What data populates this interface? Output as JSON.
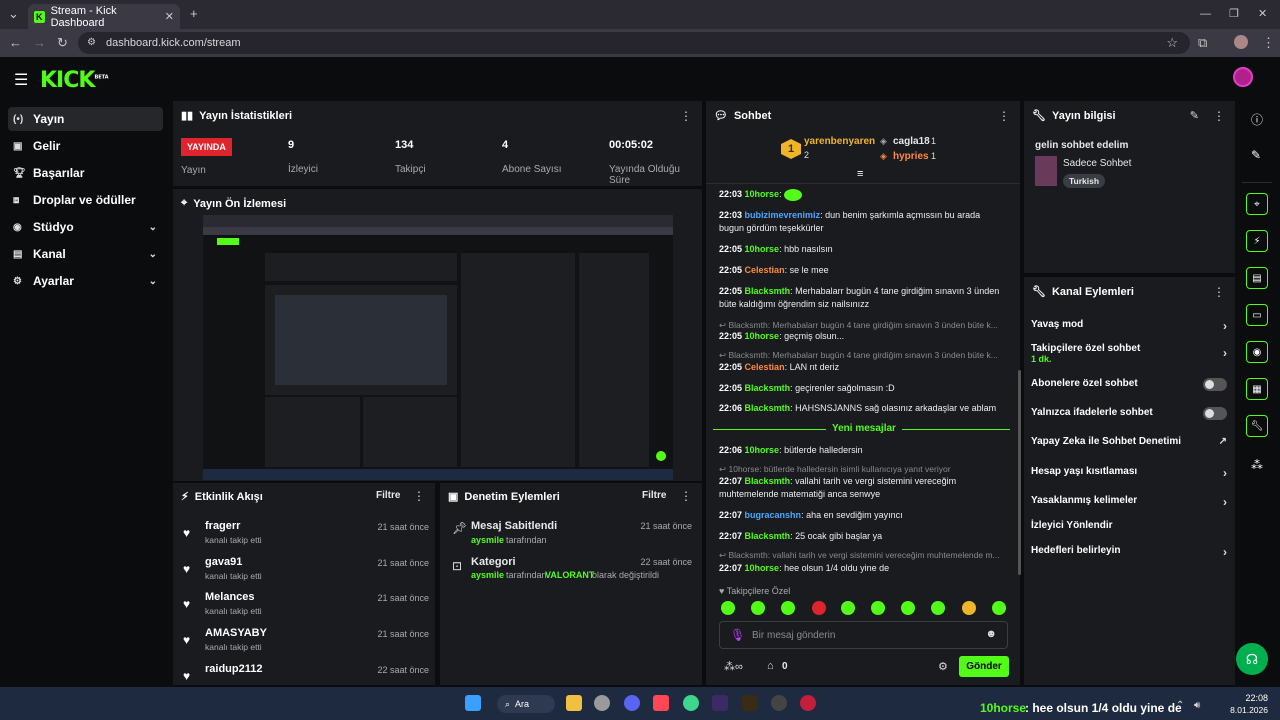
{
  "browser": {
    "tab_title": "Stream - Kick Dashboard",
    "url": "dashboard.kick.com/stream"
  },
  "logo": "KICK",
  "logo_beta": "BETA",
  "sidebar": [
    {
      "label": "Yayın",
      "icon": "broadcast-icon"
    },
    {
      "label": "Gelir",
      "icon": "money-icon"
    },
    {
      "label": "Başarılar",
      "icon": "trophy-icon"
    },
    {
      "label": "Droplar ve ödüller",
      "icon": "gift-icon"
    },
    {
      "label": "Stüdyo",
      "icon": "studio-icon"
    },
    {
      "label": "Kanal",
      "icon": "channel-icon"
    },
    {
      "label": "Ayarlar",
      "icon": "gear-icon"
    }
  ],
  "stats": {
    "title": "Yayın İstatistikleri",
    "live_badge": "YAYINDA",
    "live_label": "Yayın",
    "items": [
      {
        "value": "9",
        "label": "İzleyici"
      },
      {
        "value": "134",
        "label": "Takipçi"
      },
      {
        "value": "4",
        "label": "Abone Sayısı"
      },
      {
        "value": "00:05:02",
        "label": "Yayında Olduğu Süre"
      }
    ]
  },
  "preview": {
    "title": "Yayın Ön İzlemesi"
  },
  "activity": {
    "title": "Etkinlik Akışı",
    "filter": "Filtre",
    "items": [
      {
        "name": "fragerr",
        "sub": "kanalı takip etti",
        "time": "21 saat önce"
      },
      {
        "name": "gava91",
        "sub": "kanalı takip etti",
        "time": "21 saat önce"
      },
      {
        "name": "Melances",
        "sub": "kanalı takip etti",
        "time": "21 saat önce"
      },
      {
        "name": "AMASYABY",
        "sub": "kanalı takip etti",
        "time": "21 saat önce"
      },
      {
        "name": "raidup2112",
        "sub": "",
        "time": "22 saat önce"
      }
    ]
  },
  "moderation": {
    "title": "Denetim Eylemleri",
    "filter": "Filtre",
    "items": [
      {
        "name": "Mesaj Sabitlendi",
        "user": "aysmile",
        "rest": "tarafından",
        "time": "21 saat önce"
      },
      {
        "name": "Kategori",
        "user": "aysmile",
        "rest": "tarafından",
        "game": "VALORANT",
        "rest2": "olarak değiştirildi",
        "time": "22 saat önce"
      }
    ]
  },
  "chat": {
    "title": "Sohbet",
    "leader": {
      "rank": "1",
      "name": "yarenbenyaren",
      "count": "2"
    },
    "others": [
      {
        "name": "cagla18",
        "count": "1"
      },
      {
        "name": "hypries",
        "count": "1"
      }
    ],
    "messages": [
      {
        "time": "22:03",
        "user": "10horse",
        "text": ":",
        "color": "#53fc18"
      },
      {
        "time": "22:03",
        "user": "bubizimevrenimiz",
        "text": ": dun benim şarkımla açmıssın bu arada bugun gördüm teşekkürler",
        "color": "#4aa8ff"
      },
      {
        "time": "22:05",
        "user": "10horse",
        "text": ": hbb nasılsın",
        "color": "#53fc18"
      },
      {
        "time": "22:05",
        "user": "Celestian",
        "text": ": se le mee",
        "color": "#ff8a3d"
      },
      {
        "time": "22:05",
        "user": "Blacksmth",
        "text": ": Merhabalarr bugün 4 tane girdiğim sınavın 3 ünden büte kaldığımı öğrendim siz nailsınızz",
        "color": "#53fc18"
      },
      {
        "reply": "Blacksmth: Merhabalarr bugün 4 tane girdiğim sınavın 3 ünden büte k..."
      },
      {
        "time": "22:05",
        "user": "10horse",
        "text": ": geçmiş olsun...",
        "color": "#53fc18"
      },
      {
        "reply": "Blacksmth: Merhabalarr bugün 4 tane girdiğim sınavın 3 ünden büte k..."
      },
      {
        "time": "22:05",
        "user": "Celestian",
        "text": ": LAN nt deriz",
        "color": "#ff8a3d"
      },
      {
        "time": "22:05",
        "user": "Blacksmth",
        "text": ": geçirenler sağolmasın :D",
        "color": "#53fc18"
      },
      {
        "time": "22:06",
        "user": "Blacksmth",
        "text": ": HAHSNSJANNS sağ olasınız arkadaşlar ve ablam",
        "color": "#53fc18"
      }
    ],
    "new_messages": "Yeni mesajlar",
    "messages2": [
      {
        "time": "22:06",
        "user": "10horse",
        "text": ": bütlerde halledersin",
        "color": "#53fc18"
      },
      {
        "reply": "10horse: bütlerde halledersin isimli kullanıcıya yanıt veriyor"
      },
      {
        "time": "22:07",
        "user": "Blacksmth",
        "text": ": vallahi tarih ve vergi sistemini vereceğim muhtemelende matematiği anca senwye",
        "color": "#53fc18"
      },
      {
        "time": "22:07",
        "user": "bugracanshn",
        "text": ": aha en sevdiğim yayıncı",
        "color": "#4aa8ff"
      },
      {
        "time": "22:07",
        "user": "Blacksmth",
        "text": ": 25 ocak gibi başlar ya",
        "color": "#53fc18"
      },
      {
        "reply": "Blacksmth: vallahi tarih ve vergi sistemini vereceğim muhtemelende m..."
      },
      {
        "time": "22:07",
        "user": "10horse",
        "text": ": hee olsun 1/4 oldu yine de",
        "color": "#53fc18"
      }
    ],
    "followers_only": "Takipçilere Özel",
    "input_placeholder": "Bir mesaj gönderin",
    "viewer_count": "0",
    "send": "Gönder"
  },
  "stream_info": {
    "title": "Yayın bilgisi",
    "stream_title": "gelin sohbet edelim",
    "category": "Sadece Sohbet",
    "tag": "Turkish"
  },
  "channel_actions": {
    "title": "Kanal Eylemleri",
    "items": [
      {
        "label": "Yavaş mod",
        "control": "chevron"
      },
      {
        "label": "Takipçilere özel sohbet",
        "sub": "1 dk.",
        "control": "chevron"
      },
      {
        "label": "Abonelere özel sohbet",
        "control": "toggle"
      },
      {
        "label": "Yalnızca ifadelerle sohbet",
        "control": "toggle"
      },
      {
        "label": "Yapay Zeka ile Sohbet Denetimi",
        "control": "external"
      },
      {
        "label": "Hesap yaşı kısıtlaması",
        "control": "chevron"
      },
      {
        "label": "Yasaklanmış kelimeler",
        "control": "chevron"
      },
      {
        "label": "İzleyici Yönlendir",
        "control": "none"
      },
      {
        "label": "Hedefleri belirleyin",
        "control": "chevron"
      }
    ]
  },
  "taskbar": {
    "search": "Ara",
    "ticker_user": "10horse",
    "ticker_text": ": hee olsun 1/4 oldu yine de",
    "time": "22:08",
    "date": "8.01.2026"
  }
}
